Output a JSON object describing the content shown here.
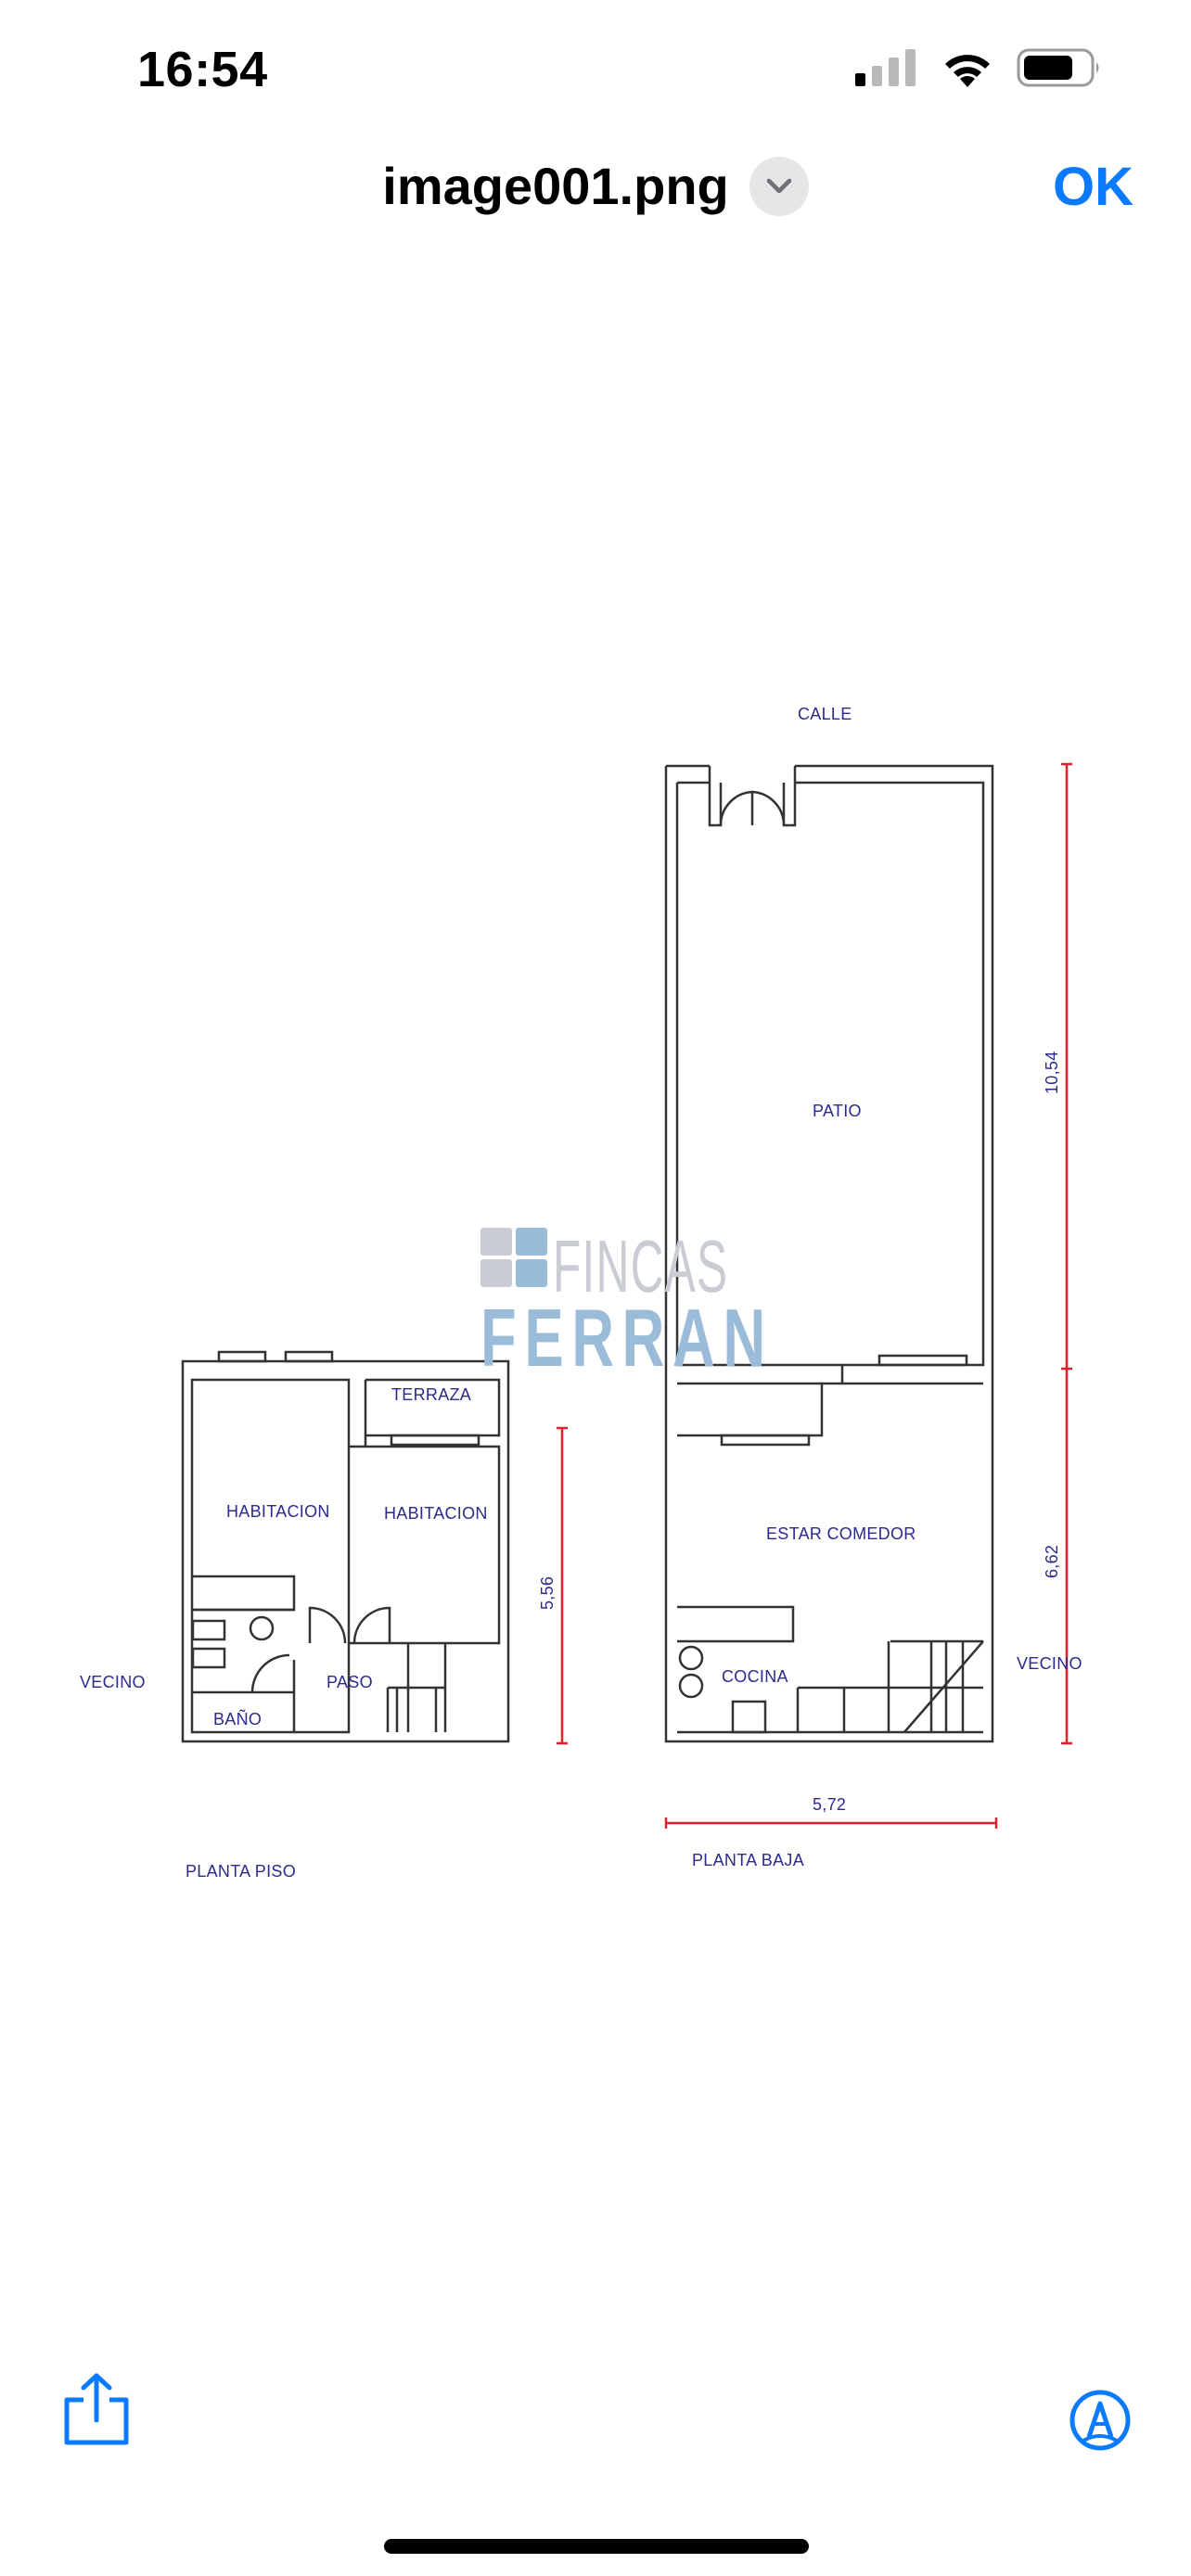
{
  "status_bar": {
    "time": "16:54"
  },
  "nav": {
    "title": "image001.png",
    "ok_label": "OK"
  },
  "plan": {
    "street_label": "CALLE",
    "rooms": {
      "patio": "PATIO",
      "terraza": "TERRAZA",
      "habitacion_1": "HABITACION",
      "habitacion_2": "HABITACION",
      "estar_comedor": "ESTAR COMEDOR",
      "paso": "PASO",
      "bano": "BAÑO",
      "cocina": "COCINA"
    },
    "neighbor_left": "VECINO",
    "neighbor_right": "VECINO",
    "dimensions": {
      "patio_length": "10,54",
      "ground_floor_length": "6,62",
      "upper_floor_length": "5,56",
      "width": "5,72"
    },
    "floor_labels": {
      "upper": "PLANTA PISO",
      "ground": "PLANTA BAJA"
    },
    "watermark": {
      "top": "FINCAS",
      "bottom": "FERRAN"
    },
    "colors": {
      "walls": "#333333",
      "text": "#2b2a8f",
      "dimension": "#e0202a"
    }
  },
  "toolbar": {
    "share_icon": "share-icon",
    "markup_icon": "markup-icon"
  },
  "colors": {
    "accent": "#0a7aff"
  }
}
